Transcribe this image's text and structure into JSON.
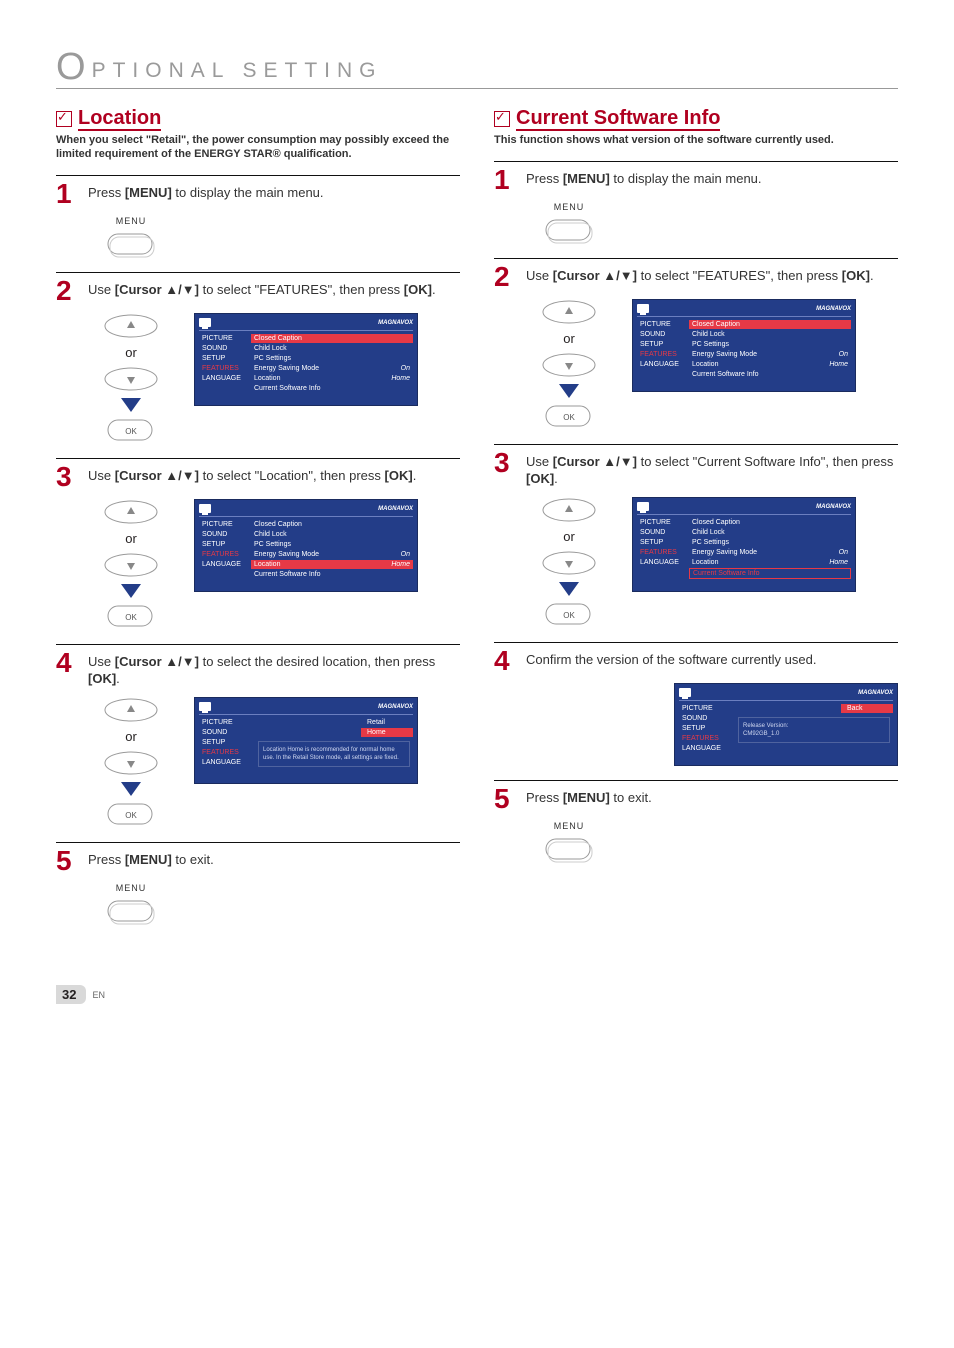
{
  "chapter": {
    "initial": "O",
    "text": "PTIONAL SETTING"
  },
  "page": {
    "number": "32",
    "lang": "EN"
  },
  "common": {
    "or": "or",
    "menu_label": "MENU",
    "ok_label": "OK",
    "brand": "MAGNAVOX",
    "osd_left": [
      "PICTURE",
      "SOUND",
      "SETUP",
      "FEATURES",
      "LANGUAGE"
    ],
    "osd_items": {
      "closed_caption": "Closed Caption",
      "child_lock": "Child Lock",
      "pc_settings": "PC Settings",
      "energy": "Energy Saving Mode",
      "location": "Location",
      "current_sw": "Current Software Info",
      "on": "On",
      "home": "Home",
      "retail": "Retail",
      "back": "Back",
      "release": "Release Version:",
      "release_val": "CM92GB_1.0",
      "loc_note": "Location Home is recommended for normal home use.\nIn the Retail Store mode, all settings are fixed."
    }
  },
  "left": {
    "title": "Location",
    "subtitle": "When you select \"Retail\", the power consumption may possibly exceed the limited requirement of the ENERGY STAR® qualification.",
    "steps": {
      "s1": "Press [MENU] to display the main menu.",
      "s2": "Use [Cursor ▲/▼] to select \"FEATURES\", then press [OK].",
      "s3": "Use [Cursor ▲/▼] to select \"Location\", then press [OK].",
      "s4": "Use [Cursor ▲/▼] to select the desired location, then press [OK].",
      "s5": "Press [MENU] to exit."
    }
  },
  "right": {
    "title": "Current Software Info",
    "subtitle": "This function shows what version of the software currently used.",
    "steps": {
      "s1": "Press [MENU] to display the main menu.",
      "s2": "Use [Cursor ▲/▼] to select \"FEATURES\", then press [OK].",
      "s3": "Use [Cursor ▲/▼] to select \"Current Software Info\", then press [OK].",
      "s4": "Confirm the version of the software currently used.",
      "s5": "Press [MENU] to exit."
    }
  }
}
